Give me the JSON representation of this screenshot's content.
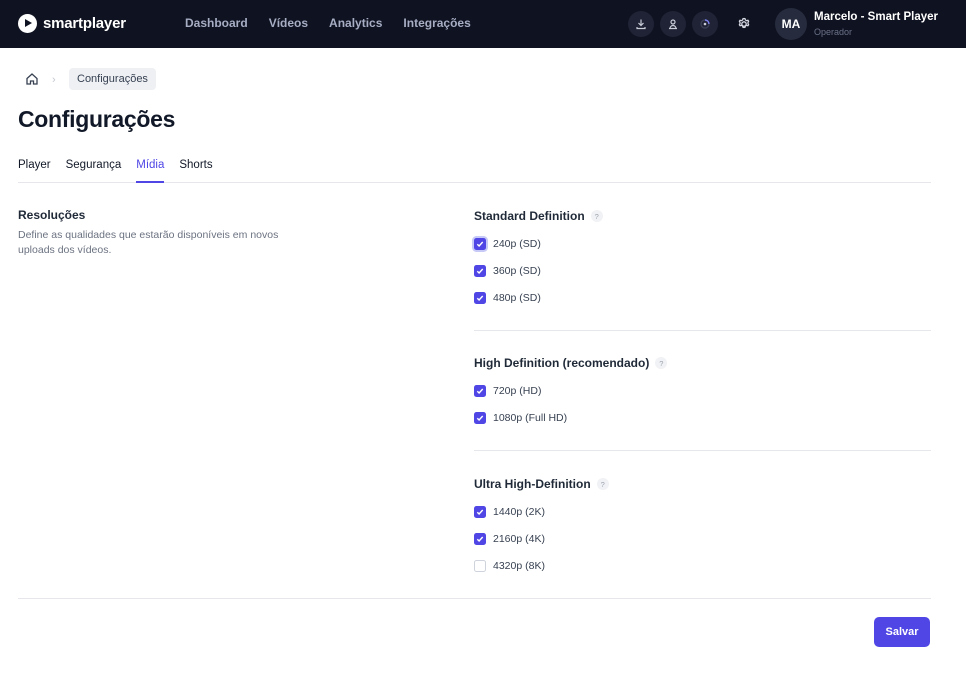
{
  "brand": {
    "name": "smartplayer"
  },
  "nav": {
    "items": [
      "Dashboard",
      "Vídeos",
      "Analytics",
      "Integrações"
    ]
  },
  "header_icons": [
    "download-icon",
    "users-icon",
    "loader-icon",
    "gear-icon"
  ],
  "user": {
    "initials": "MA",
    "name": "Marcelo - Smart Player",
    "role": "Operador"
  },
  "breadcrumb": {
    "current": "Configurações"
  },
  "page": {
    "title": "Configurações"
  },
  "tabs": [
    {
      "label": "Player",
      "active": false
    },
    {
      "label": "Segurança",
      "active": false
    },
    {
      "label": "Mídia",
      "active": true
    },
    {
      "label": "Shorts",
      "active": false
    }
  ],
  "section": {
    "title": "Resoluções",
    "description": "Define as qualidades que estarão disponíveis em novos uploads dos vídeos."
  },
  "groups": [
    {
      "title": "Standard Definition",
      "help": "?",
      "options": [
        {
          "label": "240p (SD)",
          "checked": true
        },
        {
          "label": "360p (SD)",
          "checked": true
        },
        {
          "label": "480p (SD)",
          "checked": true
        }
      ]
    },
    {
      "title": "High Definition (recomendado)",
      "help": "?",
      "options": [
        {
          "label": "720p (HD)",
          "checked": true
        },
        {
          "label": "1080p (Full HD)",
          "checked": true
        }
      ]
    },
    {
      "title": "Ultra High-Definition",
      "help": "?",
      "options": [
        {
          "label": "1440p (2K)",
          "checked": true
        },
        {
          "label": "2160p (4K)",
          "checked": true
        },
        {
          "label": "4320p (8K)",
          "checked": false
        }
      ]
    }
  ],
  "actions": {
    "save_label": "Salvar"
  },
  "colors": {
    "accent": "#4f46e5",
    "topbar": "#0f1220"
  }
}
